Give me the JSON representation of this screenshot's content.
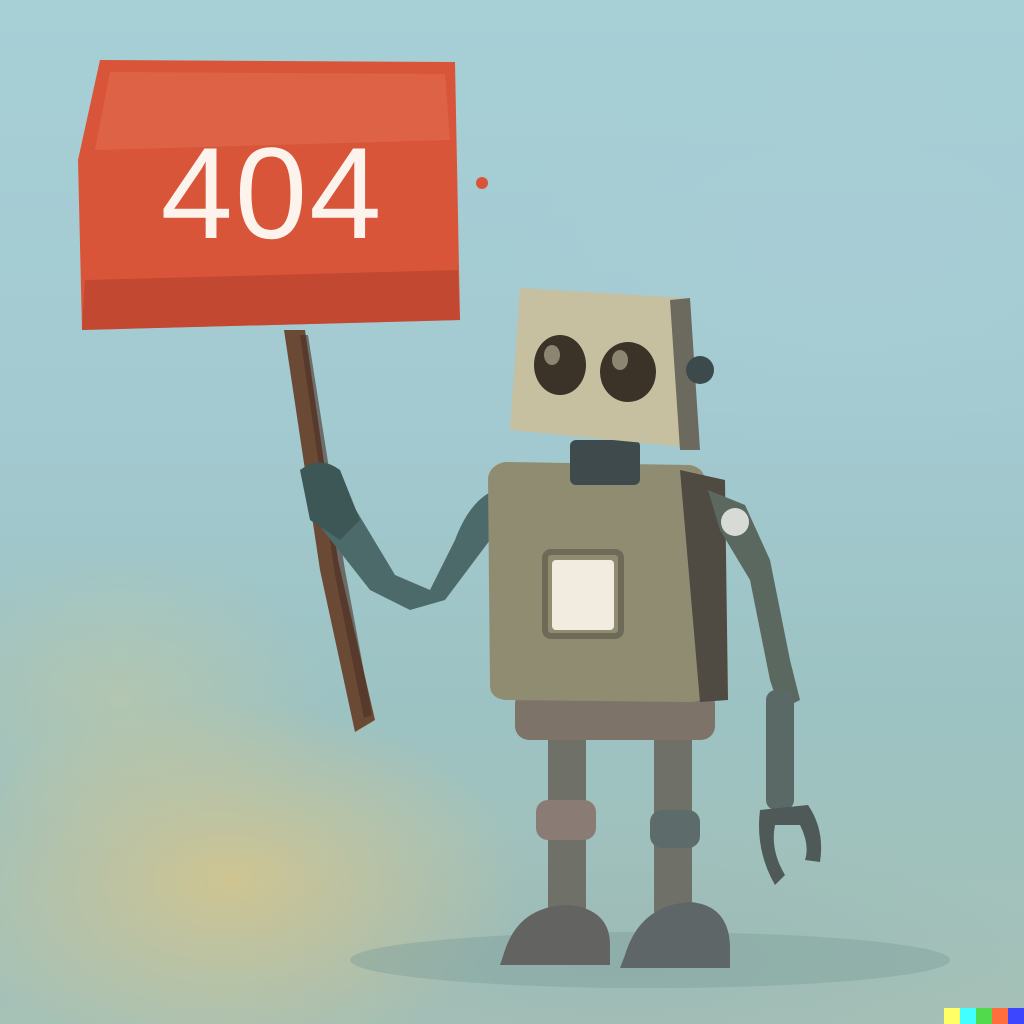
{
  "sign": {
    "text": "404"
  },
  "colors": {
    "sign_red": "#d9553a",
    "robot_body": "#8f8c72",
    "robot_head": "#c6bfa0",
    "pole": "#6b4a35",
    "background": "#a3cad1"
  },
  "watermark": {
    "colors": [
      "#ffff66",
      "#42ffff",
      "#51da4c",
      "#ff6e3c",
      "#3c46ff"
    ]
  }
}
